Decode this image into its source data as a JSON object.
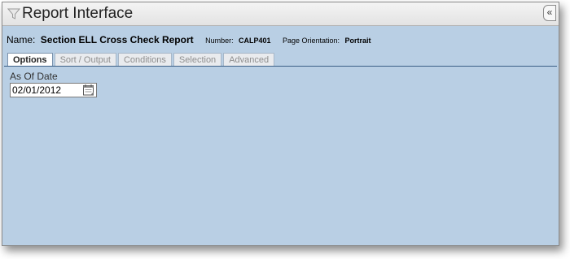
{
  "window": {
    "title": "Report Interface",
    "title_icon": "funnel-icon",
    "collapse_label": "«"
  },
  "report": {
    "name_label": "Name:",
    "name": "Section ELL Cross Check Report",
    "number_label": "Number:",
    "number": "CALP401",
    "orientation_label": "Page Orientation:",
    "orientation": "Portrait"
  },
  "tabs": [
    {
      "label": "Options",
      "active": true
    },
    {
      "label": "Sort / Output",
      "active": false
    },
    {
      "label": "Conditions",
      "active": false
    },
    {
      "label": "Selection",
      "active": false
    },
    {
      "label": "Advanced",
      "active": false
    }
  ],
  "options": {
    "as_of_date_label": "As Of Date",
    "as_of_date_value": "02/01/2012",
    "calendar_icon": "calendar-icon"
  },
  "colors": {
    "panel_background": "#b9cfe4",
    "tab_rule": "#3b5f86"
  }
}
